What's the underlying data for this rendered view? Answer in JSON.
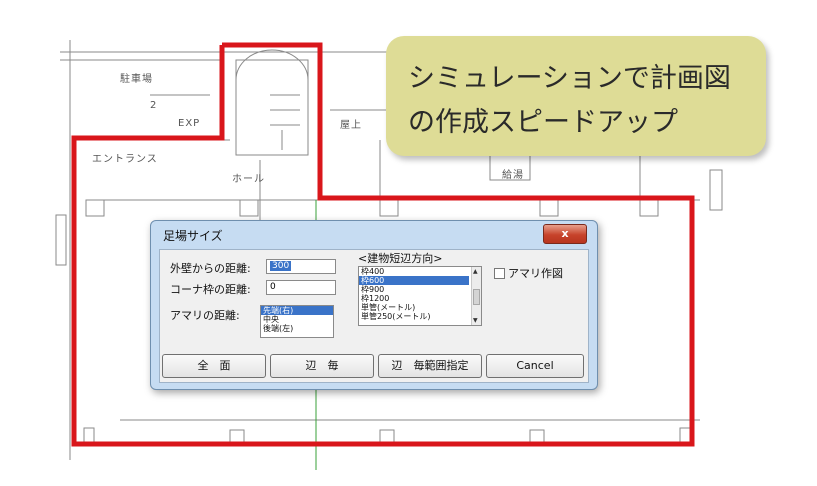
{
  "callout": {
    "line1": "シミュレーションで計画図",
    "line2": "の作成スピードアップ"
  },
  "blueprint": {
    "labels": [
      "駐車場",
      "EXP",
      "エントランス",
      "ホール",
      "給湯",
      "屋上",
      "2"
    ],
    "accent_color": "#d9161b"
  },
  "dialog": {
    "title": "足場サイズ",
    "close_label": "x",
    "outer_distance_label": "外壁からの距離:",
    "outer_distance_value": "300",
    "corner_distance_label": "コーナ枠の距離:",
    "corner_distance_value": "0",
    "amari_distance_label": "アマリの距離:",
    "amari_options": [
      "先端(右)",
      "中央",
      "後端(左)"
    ],
    "amari_selected": "先端(右)",
    "direction_label": "<建物短辺方向>",
    "direction_options": [
      "枠400",
      "枠600",
      "枠900",
      "枠1200",
      "単管(メートル)",
      "単管250(メートル)"
    ],
    "direction_selected": "枠600",
    "amari_drawing_label": "アマリ作図",
    "amari_drawing_checked": false,
    "buttons": {
      "all": "全　面",
      "each_side": "辺　毎",
      "each_side_range": "辺　毎範囲指定",
      "cancel": "Cancel"
    }
  }
}
